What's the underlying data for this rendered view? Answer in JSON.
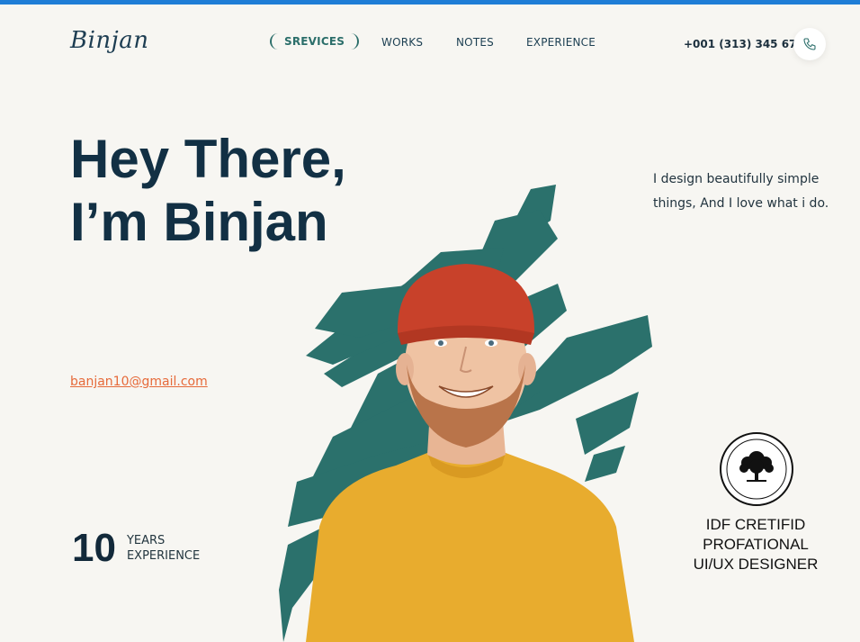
{
  "brand": {
    "logo": "Binjan"
  },
  "nav": {
    "items": [
      "SREVICES",
      "WORKS",
      "NOTES",
      "EXPERIENCE"
    ],
    "active": "SREVICES"
  },
  "contact": {
    "phone": "+001 (313) 345 678",
    "email": "banjan10@gmail.com"
  },
  "hero": {
    "line1": "Hey There,",
    "line2": "I’m Binjan",
    "tagline": "I design beautifully simple things, And I love what i do."
  },
  "experience": {
    "years": "10",
    "label_line1": "YEARS",
    "label_line2": "EXPERIENCE"
  },
  "certification": {
    "line1": "IDF CRETIFID",
    "line2": "PROFATIONAL",
    "line3": "UI/UX DESIGNER"
  },
  "colors": {
    "accent": "#2b6e6a",
    "brush": "#2b716c",
    "email": "#e66a3a",
    "heading": "#123044",
    "sweater": "#e8ac2e",
    "beanie": "#c8412a"
  },
  "icons": [
    "phone-icon",
    "tree-seal-icon"
  ]
}
